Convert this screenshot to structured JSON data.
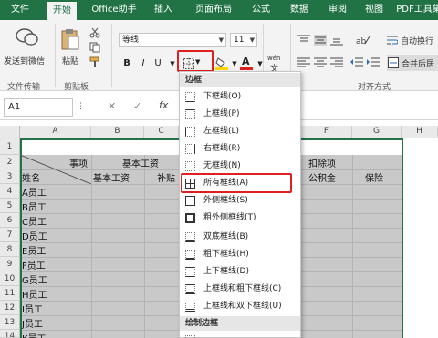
{
  "ribbon_tabs": [
    "文件",
    "开始",
    "Office助手",
    "插入",
    "页面布局",
    "公式",
    "数据",
    "审阅",
    "视图",
    "PDF工具集"
  ],
  "active_tab": "开始",
  "ribbon": {
    "send_wechat": "发送到微信",
    "paste": "粘贴",
    "font_name": "等线",
    "font_size": "11",
    "bold": "B",
    "italic": "I",
    "underline": "U",
    "wrap_text": "自动换行",
    "merge_center": "合并后居",
    "wen_label": "wén",
    "groups": {
      "file_transfer": "文件传输",
      "clipboard": "剪贴板",
      "alignment": "对齐方式"
    }
  },
  "formula_bar": {
    "name_box": "A1",
    "fx": "fx"
  },
  "sheet": {
    "columns": [
      "A",
      "B",
      "C",
      "F",
      "G",
      "H"
    ],
    "rows": [
      "1",
      "2",
      "3",
      "4",
      "5",
      "6",
      "7",
      "8",
      "9",
      "10",
      "11",
      "12",
      "13",
      "14"
    ],
    "header_row2": {
      "item": "事项",
      "basic_salary": "基本工资",
      "deductions": "扣除项"
    },
    "header_row3": {
      "name": "姓名",
      "basic_salary": "基本工资",
      "subsidy": "补贴",
      "fund": "公积金",
      "insurance": "保险"
    },
    "employees": [
      "A员工",
      "B员工",
      "C员工",
      "D员工",
      "E员工",
      "F员工",
      "G员工",
      "H员工",
      "I员工",
      "J员工",
      "K员工"
    ]
  },
  "border_menu": {
    "section_border": "边框",
    "items": [
      "下框线(O)",
      "上框线(P)",
      "左框线(L)",
      "右框线(R)",
      "无框线(N)",
      "所有框线(A)",
      "外侧框线(S)",
      "粗外侧框线(T)",
      "双底框线(B)",
      "粗下框线(H)",
      "上下框线(D)",
      "上框线和粗下框线(C)",
      "上框线和双下框线(U)"
    ],
    "section_draw": "绘制边框",
    "highlighted": "所有框线(A)"
  },
  "colors": {
    "excel_green": "#217346",
    "highlight_red": "#e02020",
    "table_gray": "#c9c9c9"
  }
}
